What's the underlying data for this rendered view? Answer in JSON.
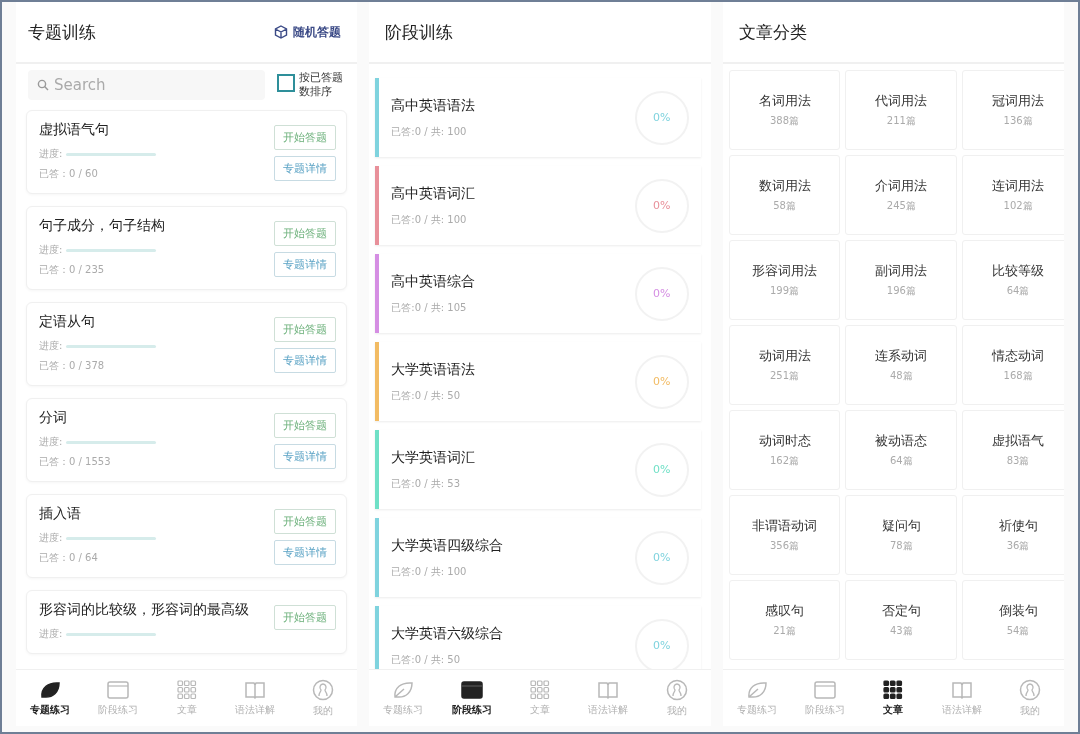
{
  "topic_screen": {
    "title": "专题训练",
    "random_button": "随机答题",
    "search": {
      "placeholder": "Search"
    },
    "sort_option": {
      "label": "按已答题数排序",
      "checked": false
    },
    "topics": [
      {
        "name": "虚拟语气句",
        "progress_label": "进度:",
        "level": 0,
        "answered": "已答：0 / 60",
        "start_button": "开始答题",
        "detail_button": "专题详情"
      },
      {
        "name": "句子成分，句子结构",
        "progress_label": "进度:",
        "level": 0,
        "answered": "已答：0 / 235",
        "start_button": "开始答题",
        "detail_button": "专题详情"
      },
      {
        "name": "定语从句",
        "progress_label": "进度:",
        "level": 0,
        "answered": "已答：0 / 378",
        "start_button": "开始答题",
        "detail_button": "专题详情"
      },
      {
        "name": "分词",
        "progress_label": "进度:",
        "level": 0,
        "answered": "已答：0 / 1553",
        "start_button": "开始答题",
        "detail_button": "专题详情"
      },
      {
        "name": "插入语",
        "progress_label": "进度:",
        "level": 0,
        "answered": "已答：0 / 64",
        "start_button": "开始答题",
        "detail_button": "专题详情"
      },
      {
        "name": "形容词的比较级，形容词的最高级",
        "progress_label": "进度:",
        "level": 0,
        "start_button": "开始答题"
      }
    ],
    "nav": [
      {
        "label": "专题练习",
        "selected": true
      },
      {
        "label": "阶段练习",
        "selected": false
      },
      {
        "label": "文章",
        "selected": false
      },
      {
        "label": "语法详解",
        "selected": false
      },
      {
        "label": "我的",
        "selected": false
      }
    ]
  },
  "stage_screen": {
    "title": "阶段训练",
    "stages": [
      {
        "name": "高中英语语法",
        "stats": "已答:0 / 共: 100",
        "percent": "0%",
        "color": "#7fd3de"
      },
      {
        "name": "高中英语词汇",
        "stats": "已答:0 / 共: 100",
        "percent": "0%",
        "color": "#e8909a"
      },
      {
        "name": "高中英语综合",
        "stats": "已答:0 / 共: 105",
        "percent": "0%",
        "color": "#d58ee3"
      },
      {
        "name": "大学英语语法",
        "stats": "已答:0 / 共: 50",
        "percent": "0%",
        "color": "#f2bb63"
      },
      {
        "name": "大学英语词汇",
        "stats": "已答:0 / 共: 53",
        "percent": "0%",
        "color": "#6fe0c6"
      },
      {
        "name": "大学英语四级综合",
        "stats": "已答:0 / 共: 100",
        "percent": "0%",
        "color": "#7fd3de"
      },
      {
        "name": "大学英语六级综合",
        "stats": "已答:0 / 共: 50",
        "percent": "0%",
        "color": "#7fd3de"
      }
    ],
    "nav": [
      {
        "label": "专题练习",
        "selected": false
      },
      {
        "label": "阶段练习",
        "selected": true
      },
      {
        "label": "文章",
        "selected": false
      },
      {
        "label": "语法详解",
        "selected": false
      },
      {
        "label": "我的",
        "selected": false
      }
    ]
  },
  "article_screen": {
    "title": "文章分类",
    "categories": [
      {
        "name": "名词用法",
        "count": "388篇"
      },
      {
        "name": "代词用法",
        "count": "211篇"
      },
      {
        "name": "冠词用法",
        "count": "136篇"
      },
      {
        "name": "数词用法",
        "count": "58篇"
      },
      {
        "name": "介词用法",
        "count": "245篇"
      },
      {
        "name": "连词用法",
        "count": "102篇"
      },
      {
        "name": "形容词用法",
        "count": "199篇"
      },
      {
        "name": "副词用法",
        "count": "196篇"
      },
      {
        "name": "比较等级",
        "count": "64篇"
      },
      {
        "name": "动词用法",
        "count": "251篇"
      },
      {
        "name": "连系动词",
        "count": "48篇"
      },
      {
        "name": "情态动词",
        "count": "168篇"
      },
      {
        "name": "动词时态",
        "count": "162篇"
      },
      {
        "name": "被动语态",
        "count": "64篇"
      },
      {
        "name": "虚拟语气",
        "count": "83篇"
      },
      {
        "name": "非谓语动词",
        "count": "356篇"
      },
      {
        "name": "疑问句",
        "count": "78篇"
      },
      {
        "name": "祈使句",
        "count": "36篇"
      },
      {
        "name": "感叹句",
        "count": "21篇"
      },
      {
        "name": "否定句",
        "count": "43篇"
      },
      {
        "name": "倒装句",
        "count": "54篇"
      }
    ],
    "nav": [
      {
        "label": "专题练习",
        "selected": false
      },
      {
        "label": "阶段练习",
        "selected": false
      },
      {
        "label": "文章",
        "selected": true
      },
      {
        "label": "语法详解",
        "selected": false
      },
      {
        "label": "我的",
        "selected": false
      }
    ]
  }
}
